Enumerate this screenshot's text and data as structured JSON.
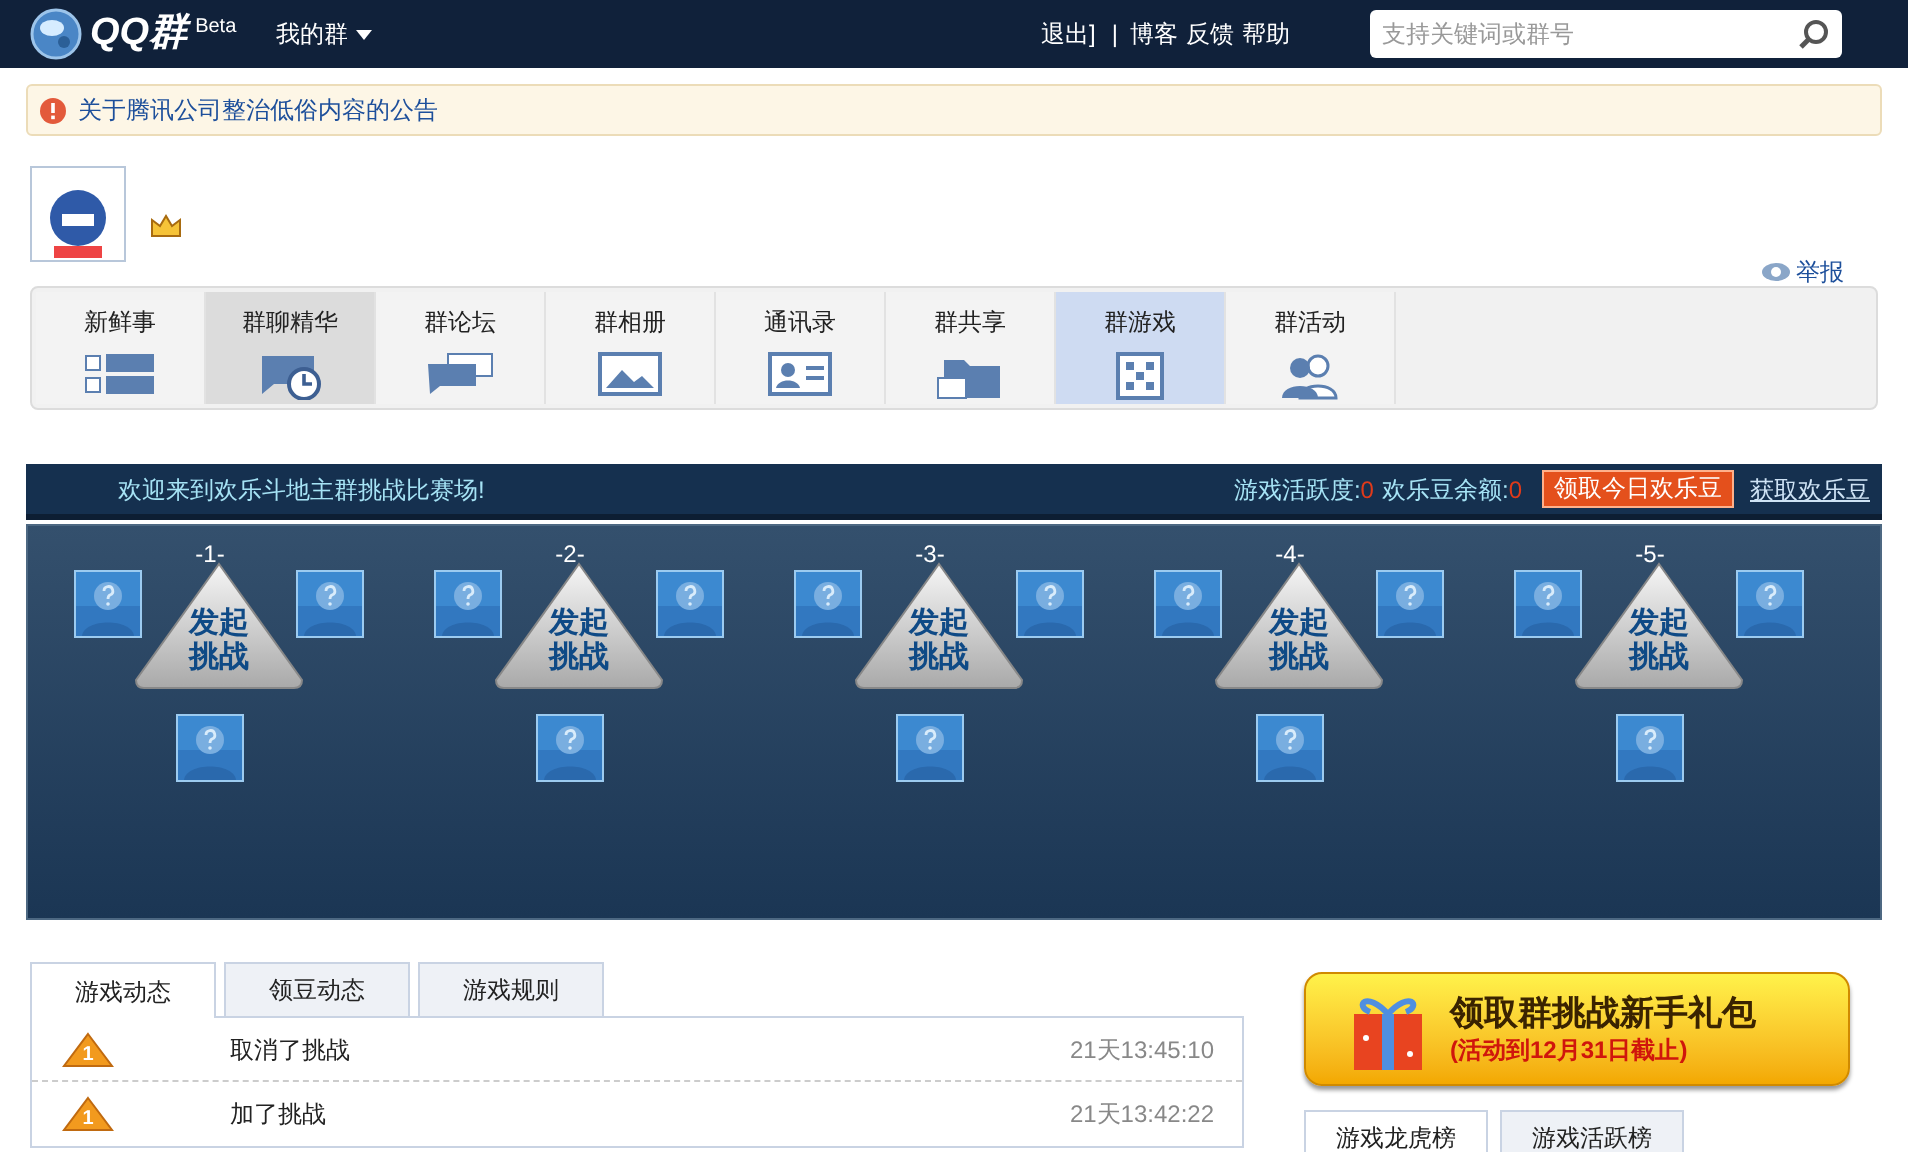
{
  "topbar": {
    "logo": "QQ群",
    "beta": "Beta",
    "my_groups": "我的群",
    "logout": "退出]",
    "separator": "|",
    "links": [
      "博客",
      "反馈",
      "帮助"
    ],
    "search": {
      "placeholder": "支持关键词或群号"
    }
  },
  "notice": "关于腾讯公司整治低俗内容的公告",
  "report": "举报",
  "tabs": [
    {
      "label": "新鲜事",
      "selected": false,
      "hovered": false
    },
    {
      "label": "群聊精华",
      "selected": false,
      "hovered": true
    },
    {
      "label": "群论坛",
      "selected": false,
      "hovered": false
    },
    {
      "label": "群相册",
      "selected": false,
      "hovered": false
    },
    {
      "label": "通讯录",
      "selected": false,
      "hovered": false
    },
    {
      "label": "群共享",
      "selected": false,
      "hovered": false
    },
    {
      "label": "群游戏",
      "selected": true,
      "hovered": false
    },
    {
      "label": "群活动",
      "selected": false,
      "hovered": false
    }
  ],
  "banner": {
    "welcome": "欢迎来到欢乐斗地主群挑战比赛场!",
    "activity_label": "游戏活跃度:",
    "activity": "0",
    "beans_label": "欢乐豆余额:",
    "beans": "0",
    "claim_button": "领取今日欢乐豆",
    "get_link": "获取欢乐豆"
  },
  "tables": [
    {
      "number": "-1-",
      "action": [
        "发起",
        "挑战"
      ]
    },
    {
      "number": "-2-",
      "action": [
        "发起",
        "挑战"
      ]
    },
    {
      "number": "-3-",
      "action": [
        "发起",
        "挑战"
      ]
    },
    {
      "number": "-4-",
      "action": [
        "发起",
        "挑战"
      ]
    },
    {
      "number": "-5-",
      "action": [
        "发起",
        "挑战"
      ]
    }
  ],
  "feed_tabs": [
    {
      "label": "游戏动态",
      "selected": true
    },
    {
      "label": "领豆动态",
      "selected": false
    },
    {
      "label": "游戏规则",
      "selected": false
    }
  ],
  "feed": [
    {
      "badge": "1",
      "text": "取消了挑战",
      "time": "21天13:45:10"
    },
    {
      "badge": "1",
      "text": "加了挑战",
      "time": "21天13:42:22"
    }
  ],
  "promo": {
    "title": "领取群挑战新手礼包",
    "note": "(活动到12月31日截止)"
  },
  "rank_tabs": [
    {
      "label": "游戏龙虎榜",
      "selected": true
    },
    {
      "label": "游戏活跃榜",
      "selected": false
    }
  ]
}
